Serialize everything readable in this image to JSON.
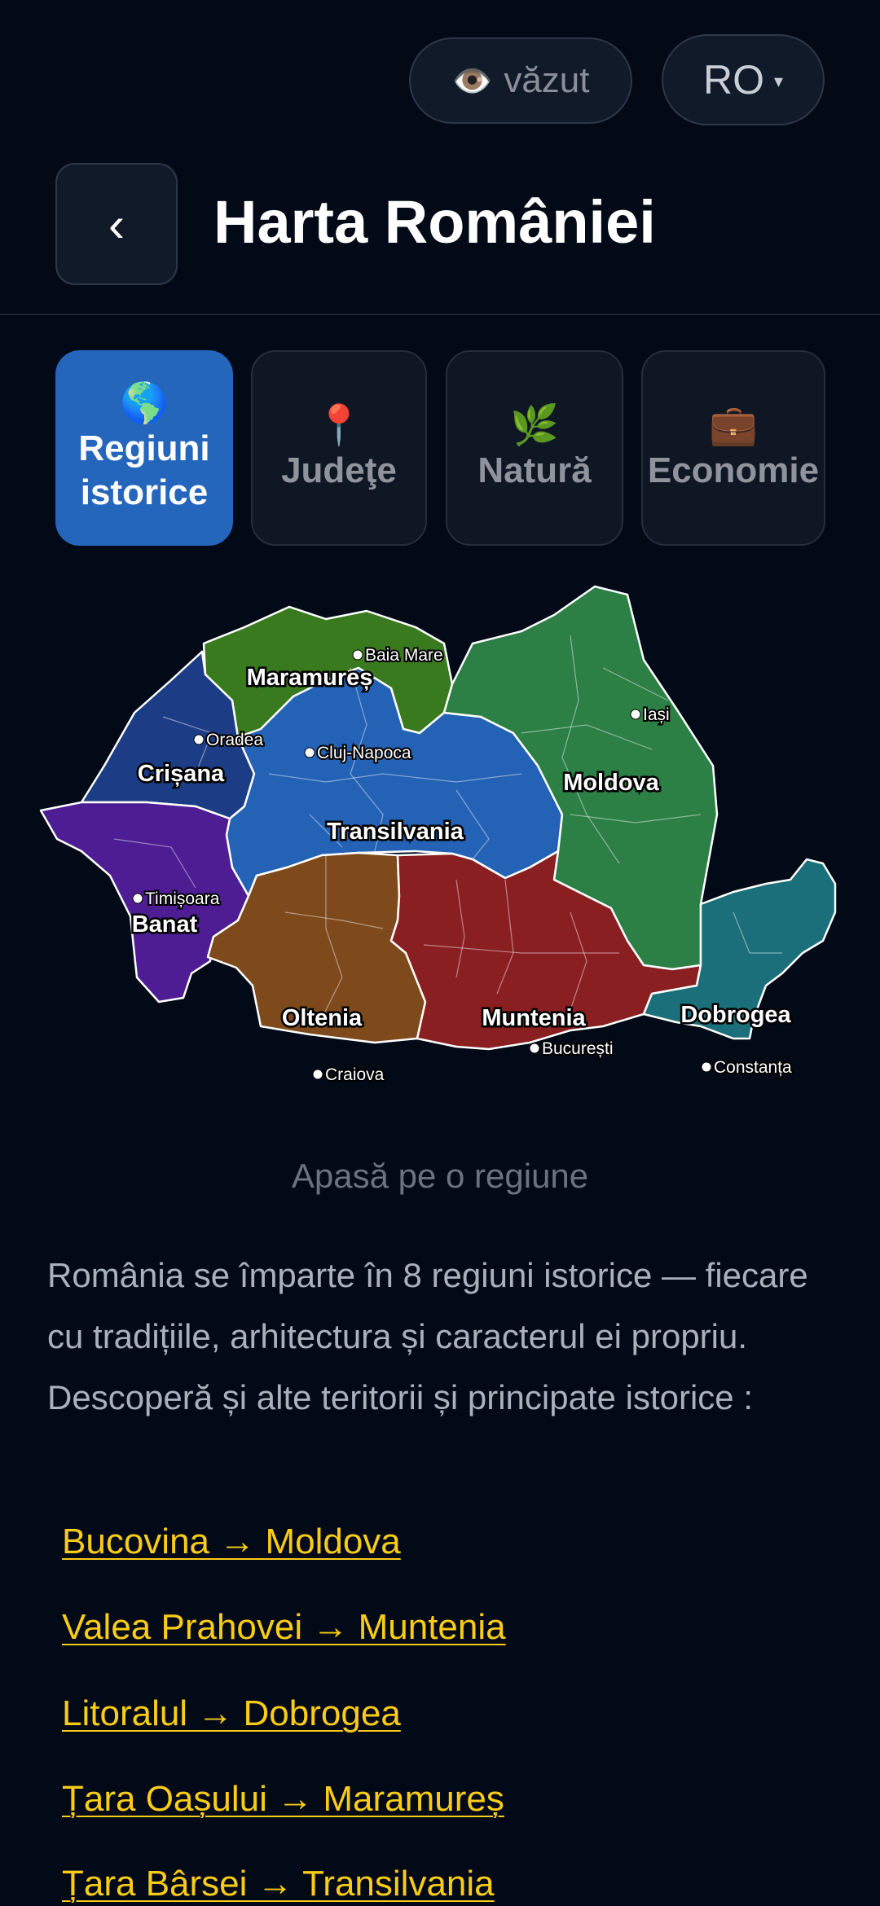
{
  "header": {
    "seen_icon": "eye-icon",
    "seen_glyph": "👁️",
    "seen_label": "văzut",
    "lang_label": "RO",
    "lang_caret": "▾",
    "back_glyph": "‹",
    "title": "Harta României"
  },
  "tabs": [
    {
      "icon": "globe-icon",
      "glyph": "🌎",
      "label": "Regiuni istorice",
      "active": true
    },
    {
      "icon": "pin-icon",
      "glyph": "📍",
      "label": "Judeţe",
      "active": false
    },
    {
      "icon": "herb-icon",
      "glyph": "🌿",
      "label": "Natură",
      "active": false
    },
    {
      "icon": "briefcase-icon",
      "glyph": "💼",
      "label": "Economie",
      "active": false
    }
  ],
  "map": {
    "regions": [
      {
        "name": "Maramureș",
        "color": "#3a7a1e"
      },
      {
        "name": "Crișana",
        "color": "#1c3d85"
      },
      {
        "name": "Transilvania",
        "color": "#2462b5"
      },
      {
        "name": "Moldova",
        "color": "#2c7f45"
      },
      {
        "name": "Banat",
        "color": "#4e1d94"
      },
      {
        "name": "Oltenia",
        "color": "#7e4a1c"
      },
      {
        "name": "Muntenia",
        "color": "#8a1f22"
      },
      {
        "name": "Dobrogea",
        "color": "#1b6f7a"
      }
    ],
    "cities": [
      "Baia Mare",
      "Oradea",
      "Cluj-Napoca",
      "Iași",
      "Timișoara",
      "Craiova",
      "București",
      "Constanța"
    ]
  },
  "hint": "Apasă pe o regiune",
  "description": "România se împarte în 8 regiuni istorice — fiecare cu tradițiile, arhitectura și caracterul ei propriu. Descoperă și alte teritorii și principate istorice :",
  "links": [
    "Bucovina → Moldova",
    "Valea Prahovei → Muntenia",
    "Litoralul → Dobrogea",
    "Țara Oașului → Maramureș",
    "Țara Bârsei → Transilvania"
  ]
}
